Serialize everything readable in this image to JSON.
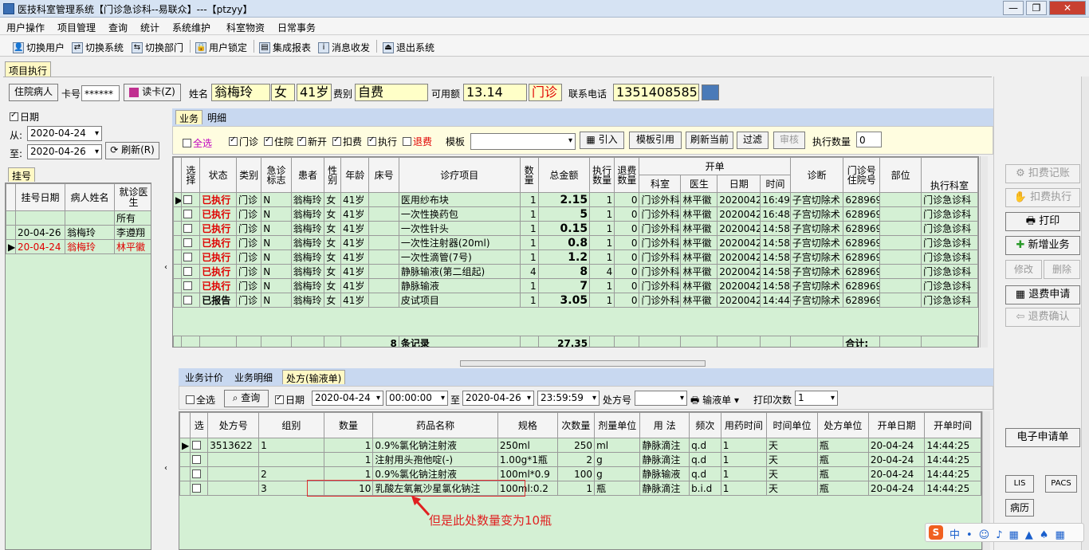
{
  "window": {
    "title": "医技科室管理系统【门诊急诊科--易联众】---【ptzyy】"
  },
  "menu": [
    "用户操作",
    "项目管理",
    "查询",
    "统计",
    "系统维护",
    "科室物资",
    "日常事务"
  ],
  "toolbar": [
    "切换用户",
    "切换系统",
    "切换部门",
    "用户锁定",
    "集成报表",
    "消息收发",
    "退出系统"
  ],
  "main_tab": "项目执行",
  "patient": {
    "type_btn": "住院病人",
    "card_label": "卡号",
    "card_value": "******",
    "read_btn": "读卡(Z)",
    "name_label": "姓名",
    "name": "翁梅玲",
    "sex": "女",
    "age": "41岁",
    "fee_label": "费别",
    "fee_type": "自费",
    "balance_label": "可用额",
    "balance": "13.14",
    "visit_type": "门诊",
    "phone_label": "联系电话",
    "phone": "13514085856"
  },
  "left": {
    "date_label": "日期",
    "from_label": "从:",
    "from": "2020-04-24",
    "to_label": "至:",
    "to": "2020-04-26",
    "refresh": "刷新(R)",
    "tab": "挂号",
    "headers": [
      "挂号日期",
      "病人姓名",
      "就诊医生"
    ],
    "rows": [
      {
        "date": "",
        "name": "",
        "doctor": "所有"
      },
      {
        "date": "20-04-26",
        "name": "翁梅玲",
        "doctor": "李遵翔"
      },
      {
        "date": "20-04-24",
        "name": "翁梅玲",
        "doctor": "林平徽"
      }
    ]
  },
  "business": {
    "tabs": [
      "业务",
      "明细"
    ],
    "select_all": "全选",
    "filters": [
      "门诊",
      "住院",
      "新开",
      "扣费",
      "执行",
      "退费"
    ],
    "template_label": "模板",
    "buttons": [
      "引入",
      "模板引用",
      "刷新当前",
      "过滤",
      "审核"
    ],
    "exec_count_label": "执行数量",
    "exec_count": "0",
    "headers": [
      "选择",
      "状态",
      "类别",
      "急诊标志",
      "患者",
      "性别",
      "年龄",
      "床号",
      "诊疗项目",
      "数量",
      "总金额",
      "执行数量",
      "退费数量",
      "开单",
      "科室",
      "医生",
      "日期",
      "时间",
      "诊断",
      "门诊号住院号",
      "部位",
      "执行科室"
    ],
    "rows": [
      {
        "status": "已执行",
        "cat": "门诊",
        "em": "N",
        "patient": "翁梅玲",
        "sex": "女",
        "age": "41岁",
        "item": "医用纱布块",
        "qty": "1",
        "amount": "2.15",
        "exec": "1",
        "refund": "0",
        "dept": "门诊外科",
        "doc": "林平徽",
        "date": "20200424",
        "time": "16:49:",
        "diag": "子宫切除术",
        "no": "628969",
        "exdept": "门诊急诊科"
      },
      {
        "status": "已执行",
        "cat": "门诊",
        "em": "N",
        "patient": "翁梅玲",
        "sex": "女",
        "age": "41岁",
        "item": "一次性换药包",
        "qty": "1",
        "amount": "5",
        "exec": "1",
        "refund": "0",
        "dept": "门诊外科",
        "doc": "林平徽",
        "date": "20200424",
        "time": "16:48:",
        "diag": "子宫切除术",
        "no": "628969",
        "exdept": "门诊急诊科"
      },
      {
        "status": "已执行",
        "cat": "门诊",
        "em": "N",
        "patient": "翁梅玲",
        "sex": "女",
        "age": "41岁",
        "item": "一次性针头",
        "qty": "1",
        "amount": "0.15",
        "exec": "1",
        "refund": "0",
        "dept": "门诊外科",
        "doc": "林平徽",
        "date": "20200424",
        "time": "14:58:",
        "diag": "子宫切除术",
        "no": "628969",
        "exdept": "门诊急诊科"
      },
      {
        "status": "已执行",
        "cat": "门诊",
        "em": "N",
        "patient": "翁梅玲",
        "sex": "女",
        "age": "41岁",
        "item": "一次性注射器(20ml)",
        "qty": "1",
        "amount": "0.8",
        "exec": "1",
        "refund": "0",
        "dept": "门诊外科",
        "doc": "林平徽",
        "date": "20200424",
        "time": "14:58:",
        "diag": "子宫切除术",
        "no": "628969",
        "exdept": "门诊急诊科"
      },
      {
        "status": "已执行",
        "cat": "门诊",
        "em": "N",
        "patient": "翁梅玲",
        "sex": "女",
        "age": "41岁",
        "item": "一次性滴管(7号)",
        "qty": "1",
        "amount": "1.2",
        "exec": "1",
        "refund": "0",
        "dept": "门诊外科",
        "doc": "林平徽",
        "date": "20200424",
        "time": "14:58:",
        "diag": "子宫切除术",
        "no": "628969",
        "exdept": "门诊急诊科"
      },
      {
        "status": "已执行",
        "cat": "门诊",
        "em": "N",
        "patient": "翁梅玲",
        "sex": "女",
        "age": "41岁",
        "item": "静脉输液(第二组起)",
        "qty": "4",
        "amount": "8",
        "exec": "4",
        "refund": "0",
        "dept": "门诊外科",
        "doc": "林平徽",
        "date": "20200424",
        "time": "14:58:",
        "diag": "子宫切除术",
        "no": "628969",
        "exdept": "门诊急诊科"
      },
      {
        "status": "已执行",
        "cat": "门诊",
        "em": "N",
        "patient": "翁梅玲",
        "sex": "女",
        "age": "41岁",
        "item": "静脉输液",
        "qty": "1",
        "amount": "7",
        "exec": "1",
        "refund": "0",
        "dept": "门诊外科",
        "doc": "林平徽",
        "date": "20200424",
        "time": "14:58:",
        "diag": "子宫切除术",
        "no": "628969",
        "exdept": "门诊急诊科"
      },
      {
        "status": "已报告",
        "cat": "门诊",
        "em": "N",
        "patient": "翁梅玲",
        "sex": "女",
        "age": "41岁",
        "item": "皮试项目",
        "qty": "1",
        "amount": "3.05",
        "exec": "1",
        "refund": "0",
        "dept": "门诊外科",
        "doc": "林平徽",
        "date": "20200424",
        "time": "14:44:",
        "diag": "子宫切除术",
        "no": "628969",
        "exdept": "门诊急诊科"
      }
    ],
    "footer": {
      "count": "8",
      "records": "条记录",
      "total": "27.35",
      "sum_label": "合计:"
    }
  },
  "prescription": {
    "tabs": [
      "业务计价",
      "业务明细",
      "处方(输液单)"
    ],
    "select_all": "全选",
    "query": "查询",
    "date_label": "日期",
    "date_from": "2020-04-24",
    "time_from": "00:00:00",
    "to_label": "至",
    "date_to": "2020-04-26",
    "time_to": "23:59:59",
    "rx_label": "处方号",
    "infusion_btn": "输液单",
    "print_label": "打印次数",
    "print_count": "1",
    "headers": [
      "选",
      "处方号",
      "组别",
      "数量",
      "药品名称",
      "规格",
      "次数量",
      "剂量单位",
      "用 法",
      "频次",
      "用药时间",
      "时间单位",
      "处方单位",
      "开单日期",
      "开单时间"
    ],
    "rows": [
      {
        "rx": "3513622",
        "group": "1",
        "qty": "1",
        "drug": "0.9%氯化钠注射液",
        "spec": "250ml",
        "dose": "250",
        "unit": "ml",
        "usage": "静脉滴注",
        "freq": "q.d",
        "dtime": "1",
        "tunit": "天",
        "runit": "瓶",
        "date": "20-04-24",
        "time": "14:44:25"
      },
      {
        "rx": "",
        "group": "",
        "qty": "1",
        "drug": "注射用头孢他啶(-)",
        "spec": "1.00g*1瓶",
        "dose": "2",
        "unit": "g",
        "usage": "静脉滴注",
        "freq": "q.d",
        "dtime": "1",
        "tunit": "天",
        "runit": "瓶",
        "date": "20-04-24",
        "time": "14:44:25"
      },
      {
        "rx": "",
        "group": "2",
        "qty": "1",
        "drug": "0.9%氯化钠注射液",
        "spec": "100ml*0.9",
        "dose": "100",
        "unit": "g",
        "usage": "静脉输液",
        "freq": "q.d",
        "dtime": "1",
        "tunit": "天",
        "runit": "瓶",
        "date": "20-04-24",
        "time": "14:44:25"
      },
      {
        "rx": "",
        "group": "3",
        "qty": "10",
        "drug": "乳酸左氧氟沙星氯化钠注",
        "spec": "100ml:0.2",
        "dose": "1",
        "unit": "瓶",
        "usage": "静脉滴注",
        "freq": "b.i.d",
        "dtime": "1",
        "tunit": "天",
        "runit": "瓶",
        "date": "20-04-24",
        "time": "14:44:25"
      }
    ]
  },
  "annotation": "但是此处数量变为10瓶",
  "right_buttons": [
    "扣费记账",
    "扣费执行",
    "打印",
    "新增业务",
    "修改",
    "删除",
    "退费申请",
    "退费确认",
    "电子申请单",
    "LIS",
    "PACS",
    "病历"
  ],
  "colors": {
    "red": "#e00000",
    "grid_bg": "#d4f0d4",
    "yellow": "#ffffc8",
    "header_blue": "#c8d8f0"
  }
}
